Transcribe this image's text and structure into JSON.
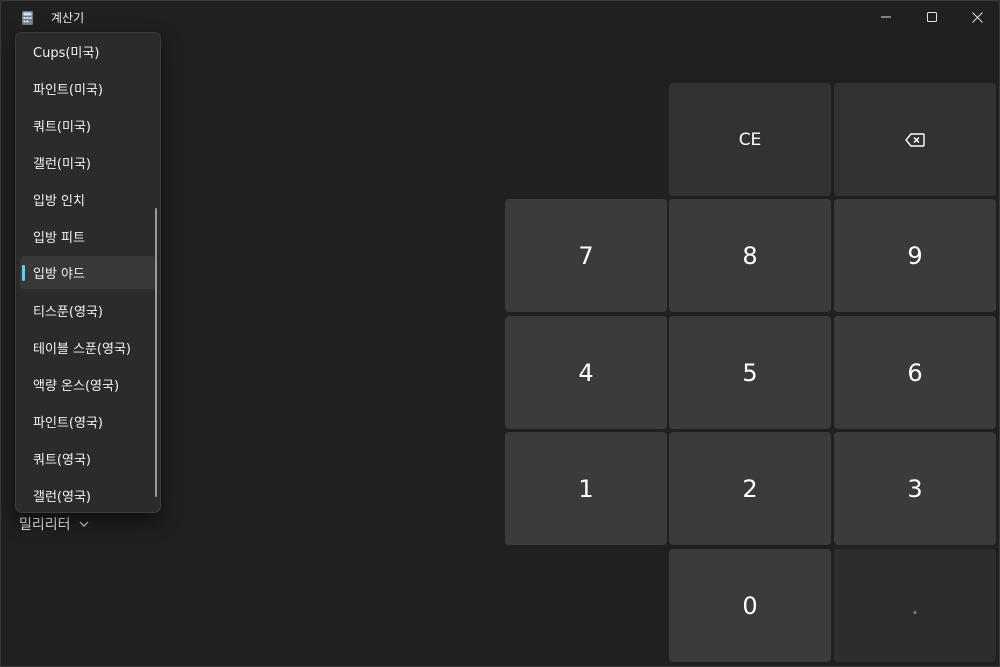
{
  "window": {
    "title": "계산기"
  },
  "keypad": {
    "ce": "CE",
    "backspace_icon": "backspace-icon",
    "digits": {
      "7": "7",
      "8": "8",
      "9": "9",
      "4": "4",
      "5": "5",
      "6": "6",
      "1": "1",
      "2": "2",
      "3": "3",
      "0": "0"
    },
    "decimal": "."
  },
  "unit_selector": {
    "value": "밀리리터"
  },
  "dropdown": {
    "items": [
      "Cups(미국)",
      "파인트(미국)",
      "쿼트(미국)",
      "갤런(미국)",
      "입방 인치",
      "입방 피트",
      "입방 야드",
      "티스푼(영국)",
      "테이블 스푼(영국)",
      "액량 온스(영국)",
      "파인트(영국)",
      "쿼트(영국)",
      "갤런(영국)"
    ],
    "selected": "입방 야드"
  },
  "colors": {
    "accent": "#60cdff",
    "background": "#202020",
    "key": "#3b3b3b"
  }
}
